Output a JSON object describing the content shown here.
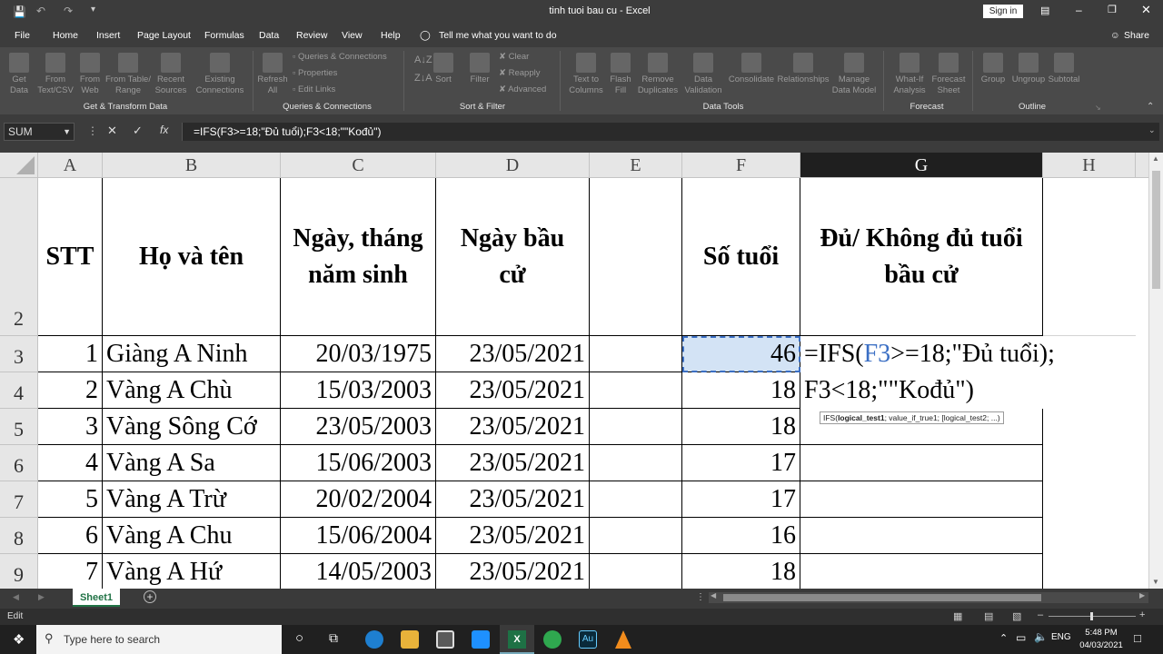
{
  "window": {
    "title": "tinh tuoi bau cu  -  Excel",
    "signin": "Sign in"
  },
  "menu": {
    "items": [
      "File",
      "Home",
      "Insert",
      "Page Layout",
      "Formulas",
      "Data",
      "Review",
      "View",
      "Help"
    ],
    "tell_me": "Tell me what you want to do",
    "share": "Share"
  },
  "ribbon": {
    "get_data": "Get Data",
    "from_text": "From Text/CSV",
    "from_web": "From Web",
    "from_table": "From Table/ Range",
    "recent_sources": "Recent Sources",
    "existing_connections": "Existing Connections",
    "group_get": "Get & Transform Data",
    "refresh_all": "Refresh All",
    "queries_connections": "Queries & Connections",
    "properties": "Properties",
    "edit_links": "Edit Links",
    "group_queries": "Queries & Connections",
    "sort": "Sort",
    "filter": "Filter",
    "clear": "Clear",
    "reapply": "Reapply",
    "advanced": "Advanced",
    "group_sort": "Sort & Filter",
    "text_to_columns": "Text to Columns",
    "flash_fill": "Flash Fill",
    "remove_duplicates": "Remove Duplicates",
    "data_validation": "Data Validation",
    "consolidate": "Consolidate",
    "relationships": "Relationships",
    "manage_data_model": "Manage Data Model",
    "group_tools": "Data Tools",
    "what_if": "What-If Analysis",
    "forecast_sheet": "Forecast Sheet",
    "group_forecast": "Forecast",
    "group": "Group",
    "ungroup": "Ungroup",
    "subtotal": "Subtotal",
    "group_outline": "Outline"
  },
  "formula_bar": {
    "name_box": "SUM",
    "fx": "fx",
    "formula": "=IFS(F3>=18;\"Đủ tuổi);F3<18;\"\"Kođủ\")"
  },
  "columns": [
    "A",
    "B",
    "C",
    "D",
    "E",
    "F",
    "G",
    "H"
  ],
  "header_row": {
    "row_num": "2",
    "stt": "STT",
    "name": "Họ và tên",
    "dob": "Ngày, tháng năm sinh",
    "election": "Ngày bầu cử",
    "age": "Số tuổi",
    "eligible": "Đủ/ Không đủ tuổi bầu cử"
  },
  "rows": [
    {
      "num": "3",
      "stt": "1",
      "name": "Giàng A Ninh",
      "dob": "20/03/1975",
      "election": "23/05/2021",
      "age": "46"
    },
    {
      "num": "4",
      "stt": "2",
      "name": "Vàng A Chù",
      "dob": "15/03/2003",
      "election": "23/05/2021",
      "age": "18"
    },
    {
      "num": "5",
      "stt": "3",
      "name": "Vàng Sông Cớ",
      "dob": "23/05/2003",
      "election": "23/05/2021",
      "age": "18"
    },
    {
      "num": "6",
      "stt": "4",
      "name": "Vàng A Sa",
      "dob": "15/06/2003",
      "election": "23/05/2021",
      "age": "17"
    },
    {
      "num": "7",
      "stt": "5",
      "name": "Vàng A Trừ",
      "dob": "20/02/2004",
      "election": "23/05/2021",
      "age": "17"
    },
    {
      "num": "8",
      "stt": "6",
      "name": "Vàng A Chu",
      "dob": "15/06/2004",
      "election": "23/05/2021",
      "age": "16"
    },
    {
      "num": "9",
      "stt": "7",
      "name": "Vàng A Hứ",
      "dob": "14/05/2003",
      "election": "23/05/2021",
      "age": "18"
    }
  ],
  "edit": {
    "line1_prefix": "=IFS(",
    "line1_ref": "F3",
    "line1_suffix": ">=18;\"Đủ tuổi);",
    "line2": "F3<18;\"\"Kođủ\")",
    "tooltip_fn": "IFS(",
    "tooltip_arg1": "logical_test1",
    "tooltip_rest": "; value_if_true1; [logical_test2; ...)"
  },
  "sheet_tab": "Sheet1",
  "status": {
    "mode": "Edit"
  },
  "taskbar": {
    "search": "Type here to search",
    "lang": "ENG",
    "time": "5:48 PM",
    "date": "04/03/2021"
  }
}
